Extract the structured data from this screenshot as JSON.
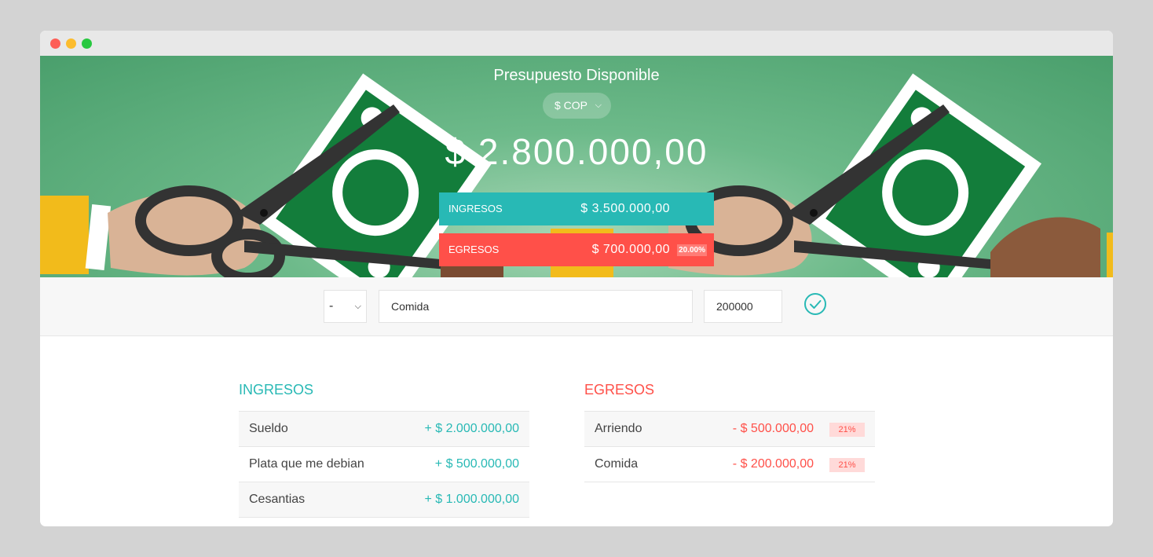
{
  "window": {
    "colors": {
      "close": "#fd5f57",
      "minimize": "#fcbc2e",
      "maximize": "#28c840"
    }
  },
  "hero": {
    "title": "Presupuesto Disponible",
    "currency": "$ COP",
    "available": "$ 2.800.000,00",
    "income_label": "INGRESOS",
    "income_total": "$ 3.500.000,00",
    "expense_label": "EGRESOS",
    "expense_total": "$ 700.000,00",
    "expense_pct": "20.00%"
  },
  "form": {
    "type_value": "-",
    "description_value": "Comida",
    "amount_value": "200000",
    "submit_icon": "check-circle-icon"
  },
  "income": {
    "title": "INGRESOS",
    "items": [
      {
        "desc": "Sueldo",
        "amount": "+ $ 2.000.000,00"
      },
      {
        "desc": "Plata que me debian",
        "amount": "+ $ 500.000,00"
      },
      {
        "desc": "Cesantias",
        "amount": "+ $ 1.000.000,00"
      }
    ]
  },
  "expenses": {
    "title": "EGRESOS",
    "items": [
      {
        "desc": "Arriendo",
        "amount": "- $ 500.000,00",
        "pct": "21%"
      },
      {
        "desc": "Comida",
        "amount": "- $ 200.000,00",
        "pct": "21%"
      }
    ]
  },
  "colors": {
    "income": "#28b9b5",
    "expense": "#ff5049"
  }
}
